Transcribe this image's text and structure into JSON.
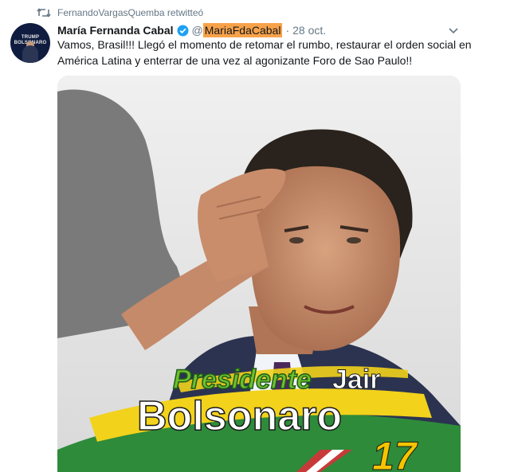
{
  "retweet": {
    "icon": "retweet-icon",
    "text": "FernandoVargasQuemba retwitteó"
  },
  "tweet": {
    "avatar_icon": "avatar-image",
    "avatar_caption": "TRUMP BOLSONARO",
    "author_name": "María Fernanda Cabal",
    "verified_icon": "verified-badge-icon",
    "handle_at": "@",
    "handle_name": "MariaFdaCabal",
    "separator": "·",
    "date": "28 oct.",
    "menu_icon": "chevron-down-icon",
    "text": "Vamos, Brasil!!! Llegó el momento de retomar el rumbo, restaurar el orden social en América Latina y enterrar de una vez al agonizante Foro de Sao Paulo!!"
  },
  "media": {
    "line1_a": "Presidente",
    "line1_b": "Jair",
    "line2": "Bolsonaro",
    "number": "17"
  },
  "colors": {
    "secondary_text": "#657786",
    "verified_blue": "#1da1f2",
    "highlight": "#f7a24a",
    "banner_green": "#2e8b3a",
    "banner_yellow": "#f2d21b",
    "number_yellow": "#f5c400"
  }
}
